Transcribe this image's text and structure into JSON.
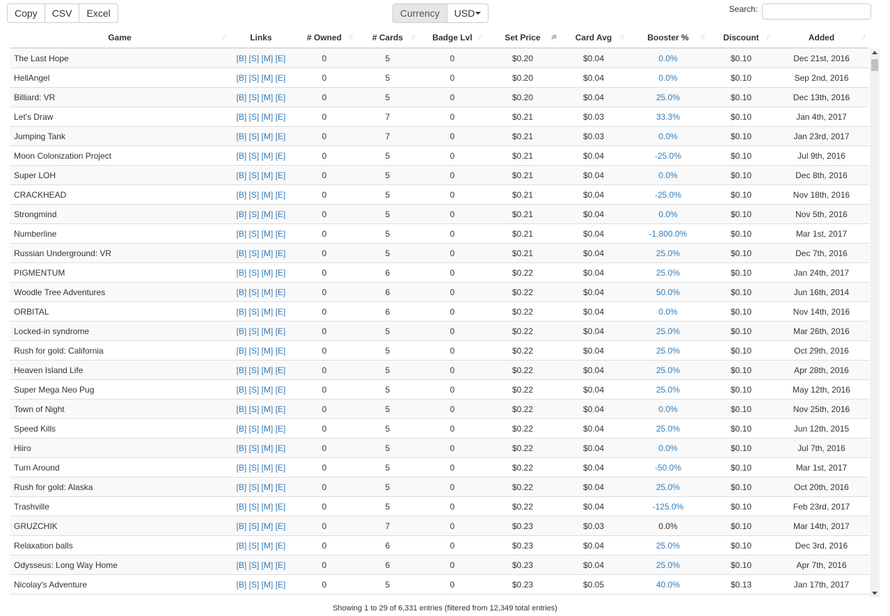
{
  "toolbar": {
    "copy_label": "Copy",
    "csv_label": "CSV",
    "excel_label": "Excel",
    "currency_label": "Currency",
    "currency_value": "USD"
  },
  "search": {
    "label": "Search:",
    "value": ""
  },
  "table": {
    "columns": [
      "Game",
      "Links",
      "# Owned",
      "# Cards",
      "Badge Lvl",
      "Set Price",
      "Card Avg",
      "Booster %",
      "Discount",
      "Added"
    ],
    "sorted_column": "Set Price",
    "links": [
      "[B]",
      "[S]",
      "[M]",
      "[E]"
    ],
    "rows": [
      [
        "The Last Hope",
        "0",
        "5",
        "0",
        "$0.20",
        "$0.04",
        "0.0%",
        "$0.10",
        "Dec 21st, 2016"
      ],
      [
        "HellAngel",
        "0",
        "5",
        "0",
        "$0.20",
        "$0.04",
        "0.0%",
        "$0.10",
        "Sep 2nd, 2016"
      ],
      [
        "Billiard: VR",
        "0",
        "5",
        "0",
        "$0.20",
        "$0.04",
        "25.0%",
        "$0.10",
        "Dec 13th, 2016"
      ],
      [
        "Let's Draw",
        "0",
        "7",
        "0",
        "$0.21",
        "$0.03",
        "33.3%",
        "$0.10",
        "Jan 4th, 2017"
      ],
      [
        "Jumping Tank",
        "0",
        "7",
        "0",
        "$0.21",
        "$0.03",
        "0.0%",
        "$0.10",
        "Jan 23rd, 2017"
      ],
      [
        "Moon Colonization Project",
        "0",
        "5",
        "0",
        "$0.21",
        "$0.04",
        "-25.0%",
        "$0.10",
        "Jul 9th, 2016"
      ],
      [
        "Super LOH",
        "0",
        "5",
        "0",
        "$0.21",
        "$0.04",
        "0.0%",
        "$0.10",
        "Dec 8th, 2016"
      ],
      [
        "CRACKHEAD",
        "0",
        "5",
        "0",
        "$0.21",
        "$0.04",
        "-25.0%",
        "$0.10",
        "Nov 18th, 2016"
      ],
      [
        "Strongmind",
        "0",
        "5",
        "0",
        "$0.21",
        "$0.04",
        "0.0%",
        "$0.10",
        "Nov 5th, 2016"
      ],
      [
        "Numberline",
        "0",
        "5",
        "0",
        "$0.21",
        "$0.04",
        "-1,800.0%",
        "$0.10",
        "Mar 1st, 2017"
      ],
      [
        "Russian Underground: VR",
        "0",
        "5",
        "0",
        "$0.21",
        "$0.04",
        "25.0%",
        "$0.10",
        "Dec 7th, 2016"
      ],
      [
        "PIGMENTUM",
        "0",
        "6",
        "0",
        "$0.22",
        "$0.04",
        "25.0%",
        "$0.10",
        "Jan 24th, 2017"
      ],
      [
        "Woodle Tree Adventures",
        "0",
        "6",
        "0",
        "$0.22",
        "$0.04",
        "50.0%",
        "$0.10",
        "Jun 16th, 2014"
      ],
      [
        "ORBITAL",
        "0",
        "6",
        "0",
        "$0.22",
        "$0.04",
        "0.0%",
        "$0.10",
        "Nov 14th, 2016"
      ],
      [
        "Locked-in syndrome",
        "0",
        "5",
        "0",
        "$0.22",
        "$0.04",
        "25.0%",
        "$0.10",
        "Mar 26th, 2016"
      ],
      [
        "Rush for gold: California",
        "0",
        "5",
        "0",
        "$0.22",
        "$0.04",
        "25.0%",
        "$0.10",
        "Oct 29th, 2016"
      ],
      [
        "Heaven Island Life",
        "0",
        "5",
        "0",
        "$0.22",
        "$0.04",
        "25.0%",
        "$0.10",
        "Apr 28th, 2016"
      ],
      [
        "Super Mega Neo Pug",
        "0",
        "5",
        "0",
        "$0.22",
        "$0.04",
        "25.0%",
        "$0.10",
        "May 12th, 2016"
      ],
      [
        "Town of Night",
        "0",
        "5",
        "0",
        "$0.22",
        "$0.04",
        "0.0%",
        "$0.10",
        "Nov 25th, 2016"
      ],
      [
        "Speed Kills",
        "0",
        "5",
        "0",
        "$0.22",
        "$0.04",
        "25.0%",
        "$0.10",
        "Jun 12th, 2015"
      ],
      [
        "Hiiro",
        "0",
        "5",
        "0",
        "$0.22",
        "$0.04",
        "0.0%",
        "$0.10",
        "Jul 7th, 2016"
      ],
      [
        "Turn Around",
        "0",
        "5",
        "0",
        "$0.22",
        "$0.04",
        "-50.0%",
        "$0.10",
        "Mar 1st, 2017"
      ],
      [
        "Rush for gold: Alaska",
        "0",
        "5",
        "0",
        "$0.22",
        "$0.04",
        "25.0%",
        "$0.10",
        "Oct 20th, 2016"
      ],
      [
        "Trashville",
        "0",
        "5",
        "0",
        "$0.22",
        "$0.04",
        "-125.0%",
        "$0.10",
        "Feb 23rd, 2017"
      ],
      [
        "GRUZCHIK",
        "0",
        "7",
        "0",
        "$0.23",
        "$0.03",
        "0.0%",
        "$0.10",
        "Mar 14th, 2017"
      ],
      [
        "Relaxation balls",
        "0",
        "6",
        "0",
        "$0.23",
        "$0.04",
        "25.0%",
        "$0.10",
        "Dec 3rd, 2016"
      ],
      [
        "Odysseus: Long Way Home",
        "0",
        "6",
        "0",
        "$0.23",
        "$0.04",
        "25.0%",
        "$0.10",
        "Apr 7th, 2016"
      ],
      [
        "Nicolay's Adventure",
        "0",
        "5",
        "0",
        "$0.23",
        "$0.05",
        "40.0%",
        "$0.13",
        "Jan 17th, 2017"
      ]
    ],
    "plain_booster_rows": [
      24
    ]
  },
  "footer": {
    "info": "Showing 1 to 29 of 6,331 entries (filtered from 12,349 total entries)"
  },
  "colors": {
    "link": "#337ab7",
    "stripe": "#f9f9f9",
    "border": "#dddddd"
  },
  "icons": {
    "sort": "sort-icon",
    "sort_active": "sort-ascending-icon",
    "caret": "caret-down-icon"
  }
}
